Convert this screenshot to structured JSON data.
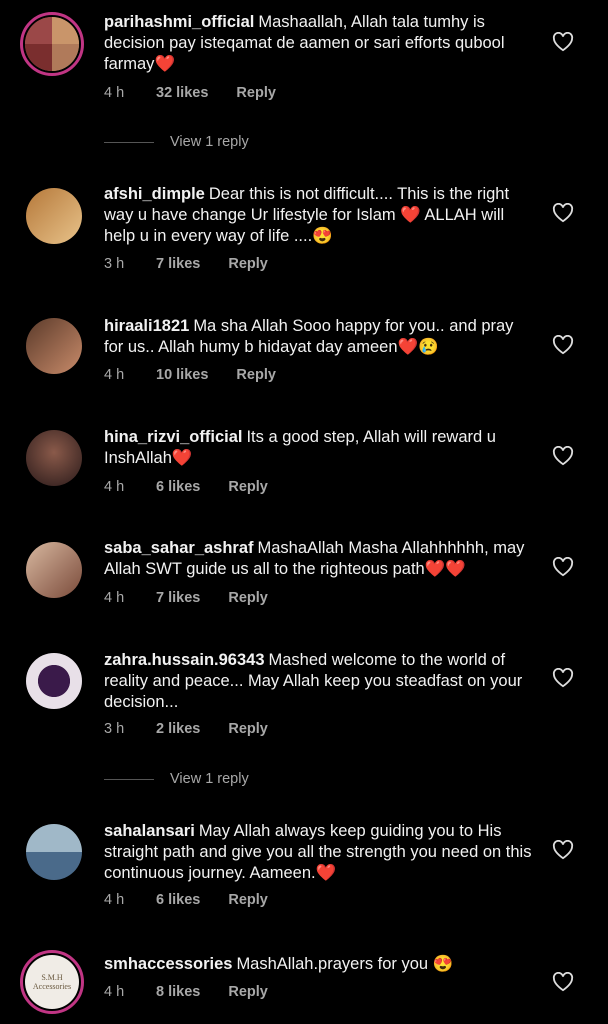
{
  "comments": [
    {
      "username": "parihashmi_official",
      "text": "Mashaallah, Allah tala tumhy is decision pay isteqamat de aamen or sari efforts qubool farmay",
      "emoji": "❤️",
      "time": "4 h",
      "likes": "32 likes",
      "reply": "Reply",
      "avatar_colors": [
        "#8a3b3b",
        "#d9b48a"
      ]
    },
    {
      "username": "afshi_dimple",
      "text": "Dear this is not difficult.... This is the right way u have change Ur lifestyle for Islam ❤️ ALLAH will help u in every way of life ....",
      "emoji": "😍",
      "time": "3 h",
      "likes": "7 likes",
      "reply": "Reply",
      "avatar_colors": [
        "#b5783a",
        "#e8c38a"
      ]
    },
    {
      "username": "hiraali1821",
      "text": "Ma sha Allah Sooo happy for you.. and pray for us.. Allah humy b hidayat day ameen",
      "emoji": "❤️😢",
      "time": "4 h",
      "likes": "10 likes",
      "reply": "Reply",
      "avatar_colors": [
        "#5a3a2a",
        "#c98b6a"
      ]
    },
    {
      "username": "hina_rizvi_official",
      "text": "Its a good step, Allah will reward u InshAllah",
      "emoji": "❤️",
      "time": "4 h",
      "likes": "6 likes",
      "reply": "Reply",
      "avatar_colors": [
        "#2a1a1a",
        "#8a5a4a"
      ]
    },
    {
      "username": "saba_sahar_ashraf",
      "text": "MashaAllah Masha Allahhhhhh, may Allah SWT guide us all to the righteous path",
      "emoji": "❤️❤️",
      "time": "4 h",
      "likes": "7 likes",
      "reply": "Reply",
      "avatar_colors": [
        "#7a4a3a",
        "#d8b8a0"
      ]
    },
    {
      "username": "zahra.hussain.96343",
      "text": "Mashed welcome to the world of reality and peace... May Allah keep you steadfast on your decision...",
      "emoji": "",
      "time": "3 h",
      "likes": "2 likes",
      "reply": "Reply",
      "avatar_colors": [
        "#3a1a4a",
        "#e8e0e8"
      ]
    },
    {
      "username": "sahalansari",
      "text": "May Allah always keep guiding you to His straight path and give you all the strength you need on this continuous journey. Aameen.",
      "emoji": "❤️",
      "time": "4 h",
      "likes": "6 likes",
      "reply": "Reply",
      "avatar_colors": [
        "#4a6a8a",
        "#a0b8c8"
      ]
    },
    {
      "username": "smhaccessories",
      "text": "MashAllah.prayers for you",
      "emoji": "😍",
      "time": "4 h",
      "likes": "8 likes",
      "reply": "Reply",
      "avatar_colors": [
        "#f0ece6",
        "#9a8a70"
      ],
      "avatar_text": "S.M.H Accessories"
    }
  ],
  "view_replies": [
    "View 1 reply",
    "View 1 reply"
  ]
}
